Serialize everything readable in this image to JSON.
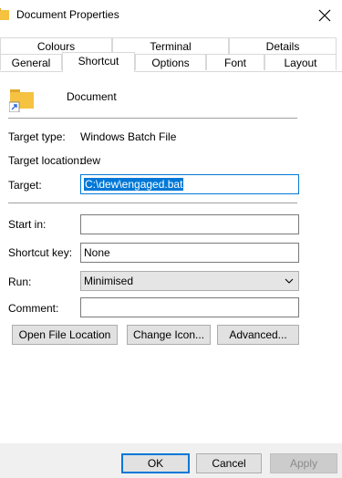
{
  "window": {
    "title": "Document Properties"
  },
  "tabs_back": [
    "Colours",
    "Terminal",
    "Details"
  ],
  "tabs_front": [
    "General",
    "Shortcut",
    "Options",
    "Font",
    "Layout"
  ],
  "active_tab": "Shortcut",
  "shortcut": {
    "name": "Document",
    "target_type_label": "Target type:",
    "target_type_value": "Windows Batch File",
    "target_location_label": "Target location:",
    "target_location_value": "dew",
    "target_label": "Target:",
    "target_value": "C:\\dew\\engaged.bat",
    "start_in_label": "Start in:",
    "start_in_value": "",
    "shortcut_key_label": "Shortcut key:",
    "shortcut_key_value": "None",
    "run_label": "Run:",
    "run_value": "Minimised",
    "comment_label": "Comment:",
    "comment_value": ""
  },
  "buttons": {
    "open_file_location": "Open File Location",
    "change_icon": "Change Icon...",
    "advanced": "Advanced...",
    "ok": "OK",
    "cancel": "Cancel",
    "apply": "Apply"
  },
  "colors": {
    "accent": "#0078d7",
    "folder": "#f5c242"
  }
}
